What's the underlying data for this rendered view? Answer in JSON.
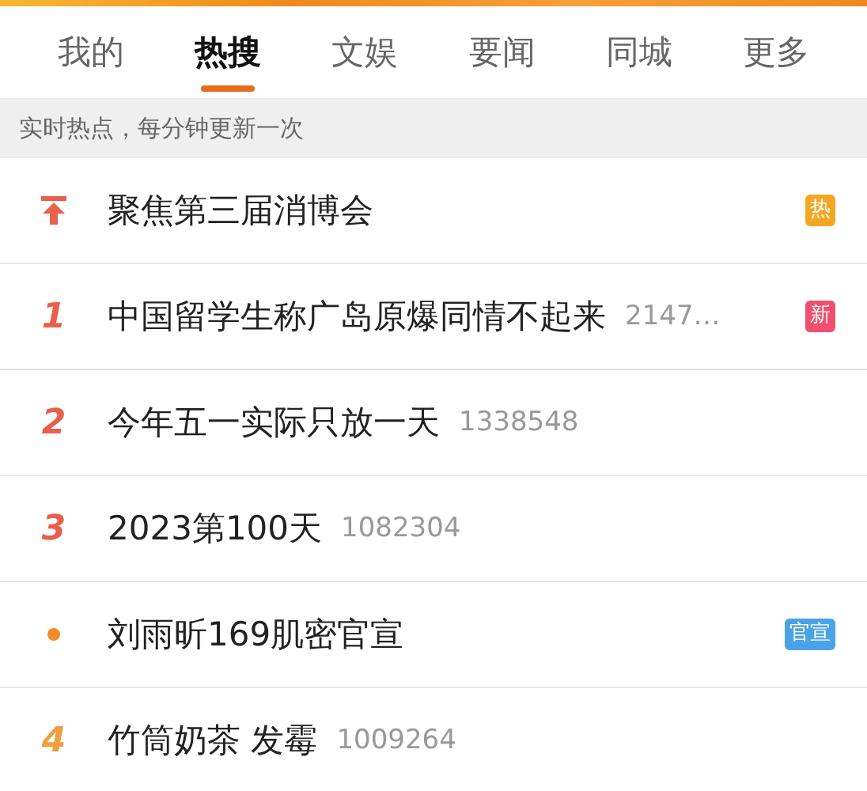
{
  "tabs": [
    {
      "label": "我的",
      "selected": false
    },
    {
      "label": "热搜",
      "selected": true
    },
    {
      "label": "文娱",
      "selected": false
    },
    {
      "label": "要闻",
      "selected": false
    },
    {
      "label": "同城",
      "selected": false
    },
    {
      "label": "更多",
      "selected": false
    }
  ],
  "notice": "实时热点，每分钟更新一次",
  "items": [
    {
      "kind": "pinned",
      "title": "聚焦第三届消博会",
      "badge": {
        "kind": "hot",
        "label": "热"
      }
    },
    {
      "kind": "number",
      "rank": "1",
      "color": "#e8604c",
      "title": "中国留学生称广岛原爆同情不起来",
      "count": "2147…",
      "badge": {
        "kind": "new",
        "label": "新"
      }
    },
    {
      "kind": "number",
      "rank": "2",
      "color": "#e8604c",
      "title": "今年五一实际只放一天",
      "count": "1338548"
    },
    {
      "kind": "number",
      "rank": "3",
      "color": "#e8604c",
      "title": "2023第100天",
      "count": "1082304"
    },
    {
      "kind": "dot",
      "color": "#f28c28",
      "title": "刘雨昕169肌密官宣",
      "badge": {
        "kind": "official",
        "label": "官宣"
      }
    },
    {
      "kind": "number",
      "rank": "4",
      "color": "#f0a040",
      "title": "竹筒奶茶 发霉",
      "count": "1009264"
    }
  ]
}
